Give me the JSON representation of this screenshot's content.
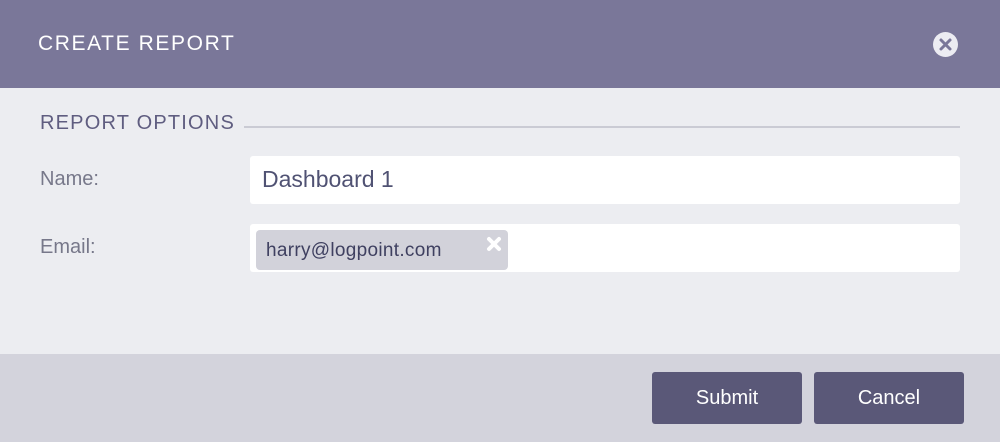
{
  "dialog": {
    "title": "CREATE REPORT",
    "close_icon": "close-circle-icon"
  },
  "section": {
    "title": "REPORT OPTIONS"
  },
  "fields": {
    "name_label": "Name:",
    "name_value": "Dashboard 1",
    "email_label": "Email:",
    "email_tags": [
      {
        "text": "harry@logpoint.com",
        "remove_icon": "remove-x-icon"
      }
    ]
  },
  "footer": {
    "submit_label": "Submit",
    "cancel_label": "Cancel"
  },
  "colors": {
    "header_bg": "#7a7799",
    "body_bg": "#ecedf1",
    "footer_bg": "#d3d3dc",
    "button_bg": "#5a5878",
    "tag_bg": "#d2d2da"
  }
}
